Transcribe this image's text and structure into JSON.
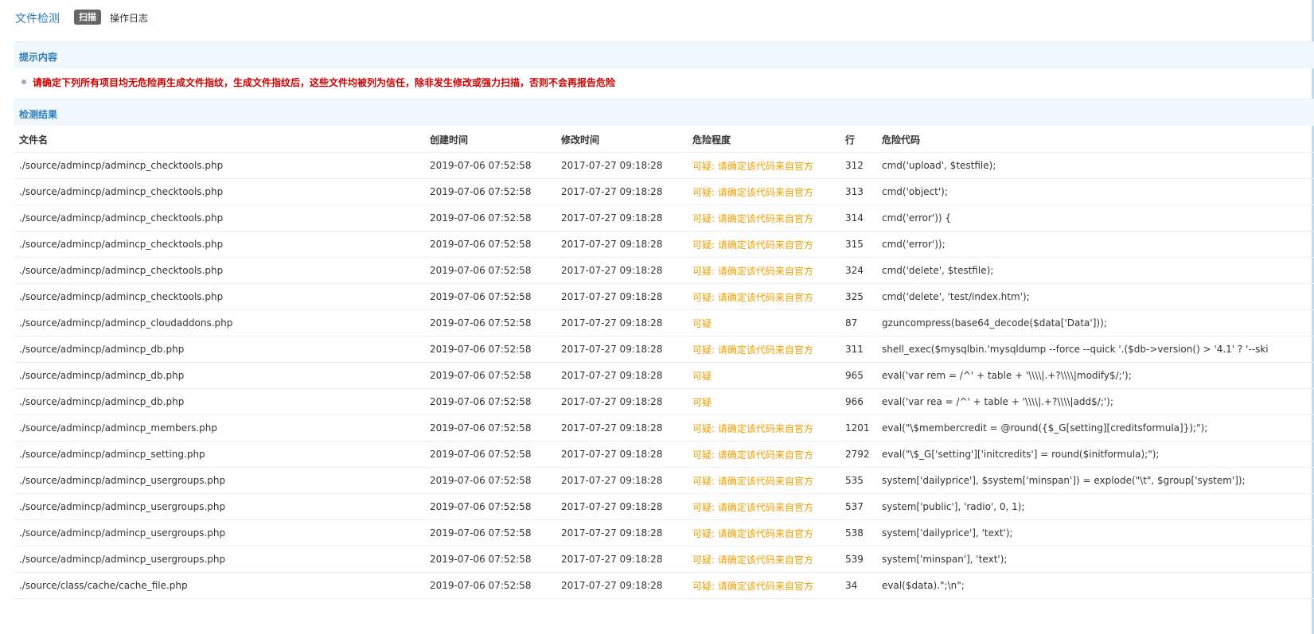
{
  "header": {
    "title": "文件检测",
    "tabs": [
      {
        "label": "扫描",
        "active": true
      },
      {
        "label": "操作日志",
        "active": false
      }
    ]
  },
  "tips": {
    "title": "提示内容",
    "text": "请确定下列所有项目均无危险再生成文件指纹，生成文件指纹后，这些文件均被列为信任，除非发生修改或强力扫描，否则不会再报告危险"
  },
  "results": {
    "title": "检测结果",
    "columns": [
      "文件名",
      "创建时间",
      "修改时间",
      "危险程度",
      "行",
      "危险代码"
    ],
    "rows": [
      {
        "file": "./source/admincp/admincp_checktools.php",
        "created": "2019-07-06 07:52:58",
        "modified": "2017-07-27 09:18:28",
        "level": "可疑: 请确定该代码来自官方",
        "line": "312",
        "code": "cmd('upload', $testfile);"
      },
      {
        "file": "./source/admincp/admincp_checktools.php",
        "created": "2019-07-06 07:52:58",
        "modified": "2017-07-27 09:18:28",
        "level": "可疑: 请确定该代码来自官方",
        "line": "313",
        "code": "cmd('object');"
      },
      {
        "file": "./source/admincp/admincp_checktools.php",
        "created": "2019-07-06 07:52:58",
        "modified": "2017-07-27 09:18:28",
        "level": "可疑: 请确定该代码来自官方",
        "line": "314",
        "code": "cmd('error')) {"
      },
      {
        "file": "./source/admincp/admincp_checktools.php",
        "created": "2019-07-06 07:52:58",
        "modified": "2017-07-27 09:18:28",
        "level": "可疑: 请确定该代码来自官方",
        "line": "315",
        "code": "cmd('error'));"
      },
      {
        "file": "./source/admincp/admincp_checktools.php",
        "created": "2019-07-06 07:52:58",
        "modified": "2017-07-27 09:18:28",
        "level": "可疑: 请确定该代码来自官方",
        "line": "324",
        "code": "cmd('delete', $testfile);"
      },
      {
        "file": "./source/admincp/admincp_checktools.php",
        "created": "2019-07-06 07:52:58",
        "modified": "2017-07-27 09:18:28",
        "level": "可疑: 请确定该代码来自官方",
        "line": "325",
        "code": "cmd('delete', 'test/index.htm');"
      },
      {
        "file": "./source/admincp/admincp_cloudaddons.php",
        "created": "2019-07-06 07:52:58",
        "modified": "2017-07-27 09:18:28",
        "level": "可疑",
        "line": "87",
        "code": "gzuncompress(base64_decode($data['Data']));"
      },
      {
        "file": "./source/admincp/admincp_db.php",
        "created": "2019-07-06 07:52:58",
        "modified": "2017-07-27 09:18:28",
        "level": "可疑: 请确定该代码来自官方",
        "line": "311",
        "code": "shell_exec($mysqlbin.'mysqldump --force --quick '.($db->version() > '4.1' ? '--ski"
      },
      {
        "file": "./source/admincp/admincp_db.php",
        "created": "2019-07-06 07:52:58",
        "modified": "2017-07-27 09:18:28",
        "level": "可疑",
        "line": "965",
        "code": "eval('var rem = /^' + table + '\\\\\\\\|.+?\\\\\\\\|modify$/;');"
      },
      {
        "file": "./source/admincp/admincp_db.php",
        "created": "2019-07-06 07:52:58",
        "modified": "2017-07-27 09:18:28",
        "level": "可疑",
        "line": "966",
        "code": "eval('var rea = /^' + table + '\\\\\\\\|.+?\\\\\\\\|add$/;');"
      },
      {
        "file": "./source/admincp/admincp_members.php",
        "created": "2019-07-06 07:52:58",
        "modified": "2017-07-27 09:18:28",
        "level": "可疑: 请确定该代码来自官方",
        "line": "1201",
        "code": "eval(\"\\$membercredit = @round({$_G[setting][creditsformula]});\");"
      },
      {
        "file": "./source/admincp/admincp_setting.php",
        "created": "2019-07-06 07:52:58",
        "modified": "2017-07-27 09:18:28",
        "level": "可疑: 请确定该代码来自官方",
        "line": "2792",
        "code": "eval(\"\\$_G['setting']['initcredits'] = round($initformula);\");"
      },
      {
        "file": "./source/admincp/admincp_usergroups.php",
        "created": "2019-07-06 07:52:58",
        "modified": "2017-07-27 09:18:28",
        "level": "可疑: 请确定该代码来自官方",
        "line": "535",
        "code": "system['dailyprice'], $system['minspan']) = explode(\"\\t\", $group['system']);"
      },
      {
        "file": "./source/admincp/admincp_usergroups.php",
        "created": "2019-07-06 07:52:58",
        "modified": "2017-07-27 09:18:28",
        "level": "可疑: 请确定该代码来自官方",
        "line": "537",
        "code": "system['public'], 'radio', 0, 1);"
      },
      {
        "file": "./source/admincp/admincp_usergroups.php",
        "created": "2019-07-06 07:52:58",
        "modified": "2017-07-27 09:18:28",
        "level": "可疑: 请确定该代码来自官方",
        "line": "538",
        "code": "system['dailyprice'], 'text');"
      },
      {
        "file": "./source/admincp/admincp_usergroups.php",
        "created": "2019-07-06 07:52:58",
        "modified": "2017-07-27 09:18:28",
        "level": "可疑: 请确定该代码来自官方",
        "line": "539",
        "code": "system['minspan'], 'text');"
      },
      {
        "file": "./source/class/cache/cache_file.php",
        "created": "2019-07-06 07:52:58",
        "modified": "2017-07-27 09:18:28",
        "level": "可疑: 请确定该代码来自官方",
        "line": "34",
        "code": "eval($data).\";\\n\";"
      }
    ]
  },
  "colors": {
    "accent": "#2b7dbc",
    "warning_text": "#cc0000",
    "danger_level": "#f09f00",
    "section_bg": "#f0f7fd"
  }
}
